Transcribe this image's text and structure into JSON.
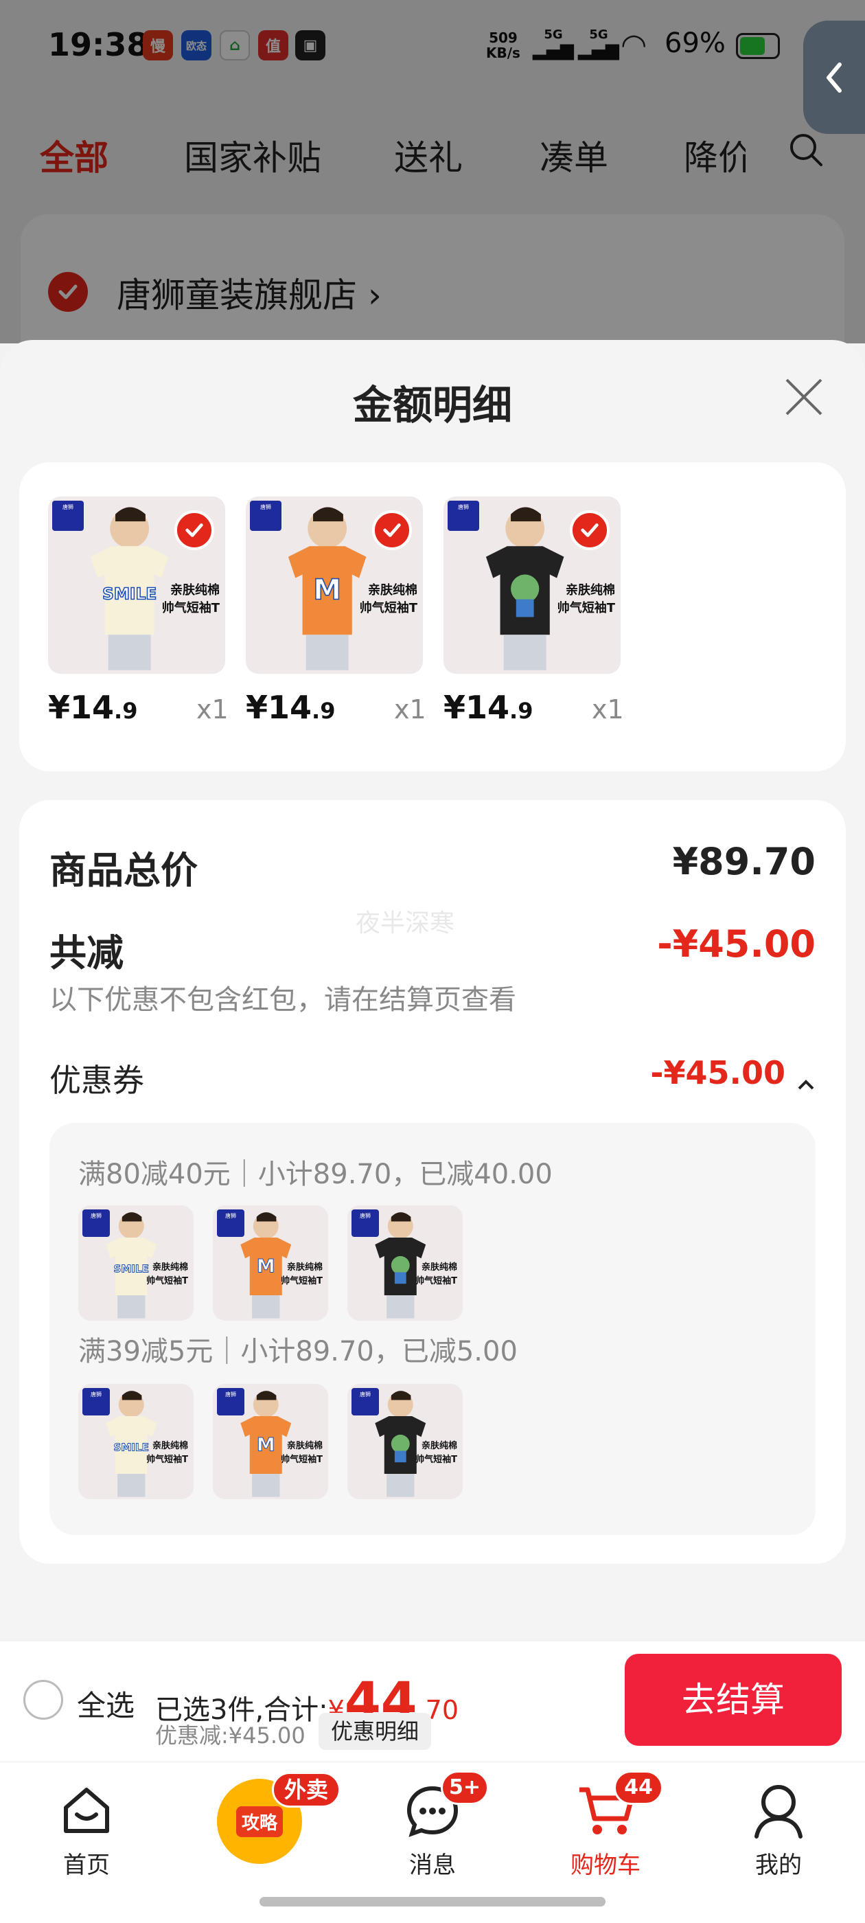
{
  "status_bar": {
    "time": "19:38",
    "net_speed_value": "509",
    "net_speed_unit": "KB/s",
    "signal1": "5G",
    "signal2": "5G",
    "battery": "69%"
  },
  "status_apps": [
    {
      "label": "慢",
      "color": "#e8391c"
    },
    {
      "label": "欧态",
      "color": "#1c5ce0"
    },
    {
      "label": "",
      "color": "#ffffff"
    },
    {
      "label": "值",
      "color": "#e02e2e"
    },
    {
      "label": "",
      "color": "#222222"
    }
  ],
  "top_tabs": [
    "全部",
    "国家补贴",
    "送礼",
    "凑单",
    "降价"
  ],
  "store": {
    "name": "唐狮童装旗舰店",
    "chevron": "›"
  },
  "sheet": {
    "title": "金额明细",
    "items": [
      {
        "price_int": "¥14",
        "price_dec": ".9",
        "qty": "x1",
        "shirt_color": "#f6f1d8",
        "design_text": "SMILE",
        "tagline1": "亲肤纯棉",
        "tagline2": "帅气短袖T"
      },
      {
        "price_int": "¥14",
        "price_dec": ".9",
        "qty": "x1",
        "shirt_color": "#f08a3a",
        "design_text": "M",
        "tagline1": "亲肤纯棉",
        "tagline2": "帅气短袖T"
      },
      {
        "price_int": "¥14",
        "price_dec": ".9",
        "qty": "x1",
        "shirt_color": "#222222",
        "design_text": "",
        "tagline1": "亲肤纯棉",
        "tagline2": "帅气短袖T"
      }
    ],
    "total_label": "商品总价",
    "total_value": "¥89.70",
    "reduce_label": "共减",
    "reduce_value": "-¥45.00",
    "reduce_note": "以下优惠不包含红包，请在结算页查看",
    "watermark": "夜半深寒",
    "coupon_label": "优惠券",
    "coupon_value": "-¥45.00",
    "coupon_groups": [
      {
        "title": "满80减40元｜小计89.70，已减40.00"
      },
      {
        "title": "满39减5元｜小计89.70，已减5.00"
      }
    ]
  },
  "bottom_bar": {
    "select_all": "全选",
    "selected_prefix": "已选3件,合计:",
    "currency": "¥",
    "total_int": "44",
    "total_dec": ".70",
    "discount": "优惠减:¥45.00",
    "detail_button": "优惠明细",
    "checkout_button": "去结算"
  },
  "nav": {
    "items": [
      {
        "label": "首页",
        "icon": "home-icon"
      },
      {
        "label": "攻略",
        "icon": "guide-icon",
        "badge": "外卖"
      },
      {
        "label": "消息",
        "icon": "message-icon",
        "badge": "5+"
      },
      {
        "label": "购物车",
        "icon": "cart-icon",
        "badge": "44"
      },
      {
        "label": "我的",
        "icon": "profile-icon"
      }
    ]
  },
  "colors": {
    "accent": "#e4271b",
    "checkout": "#f2213b",
    "text": "#222222",
    "muted": "#888888"
  }
}
